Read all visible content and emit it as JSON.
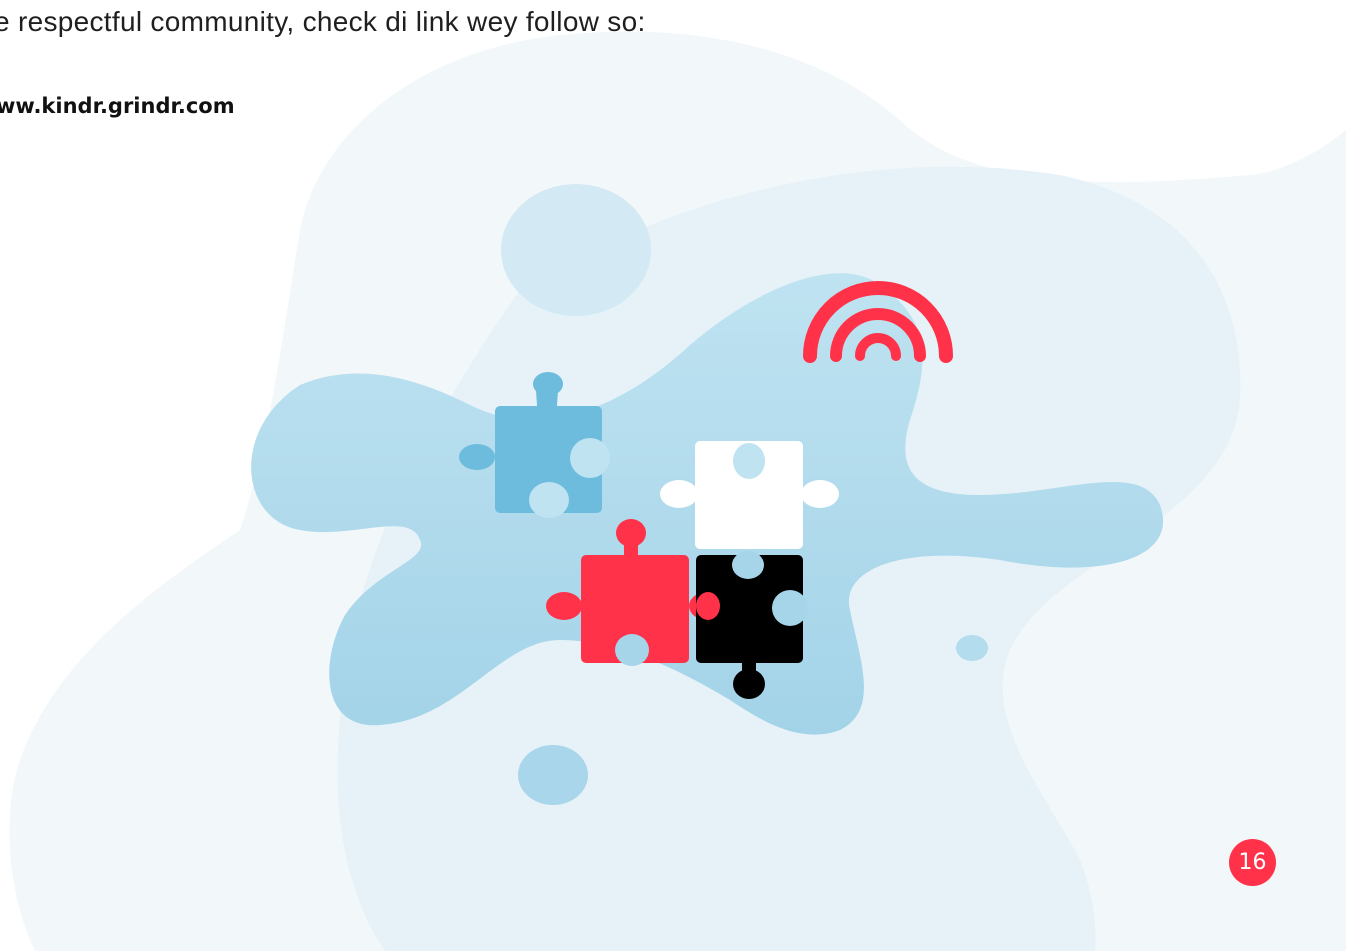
{
  "page": {
    "intro_text": "e respectful community, check di link wey follow so:",
    "link_text": "ww.kindr.grindr.com",
    "page_number": "16"
  },
  "illustration": {
    "icons": [
      "puzzle-piece-blue-icon",
      "puzzle-piece-white-icon",
      "puzzle-piece-red-icon",
      "puzzle-piece-black-icon",
      "rainbow-icon"
    ]
  },
  "colors": {
    "accent_red": "#ff3249",
    "puzzle_blue": "#6dbcde",
    "puzzle_black": "#000000",
    "blob_light": "#eef5f9",
    "blob_blue": "#b7dfee"
  }
}
